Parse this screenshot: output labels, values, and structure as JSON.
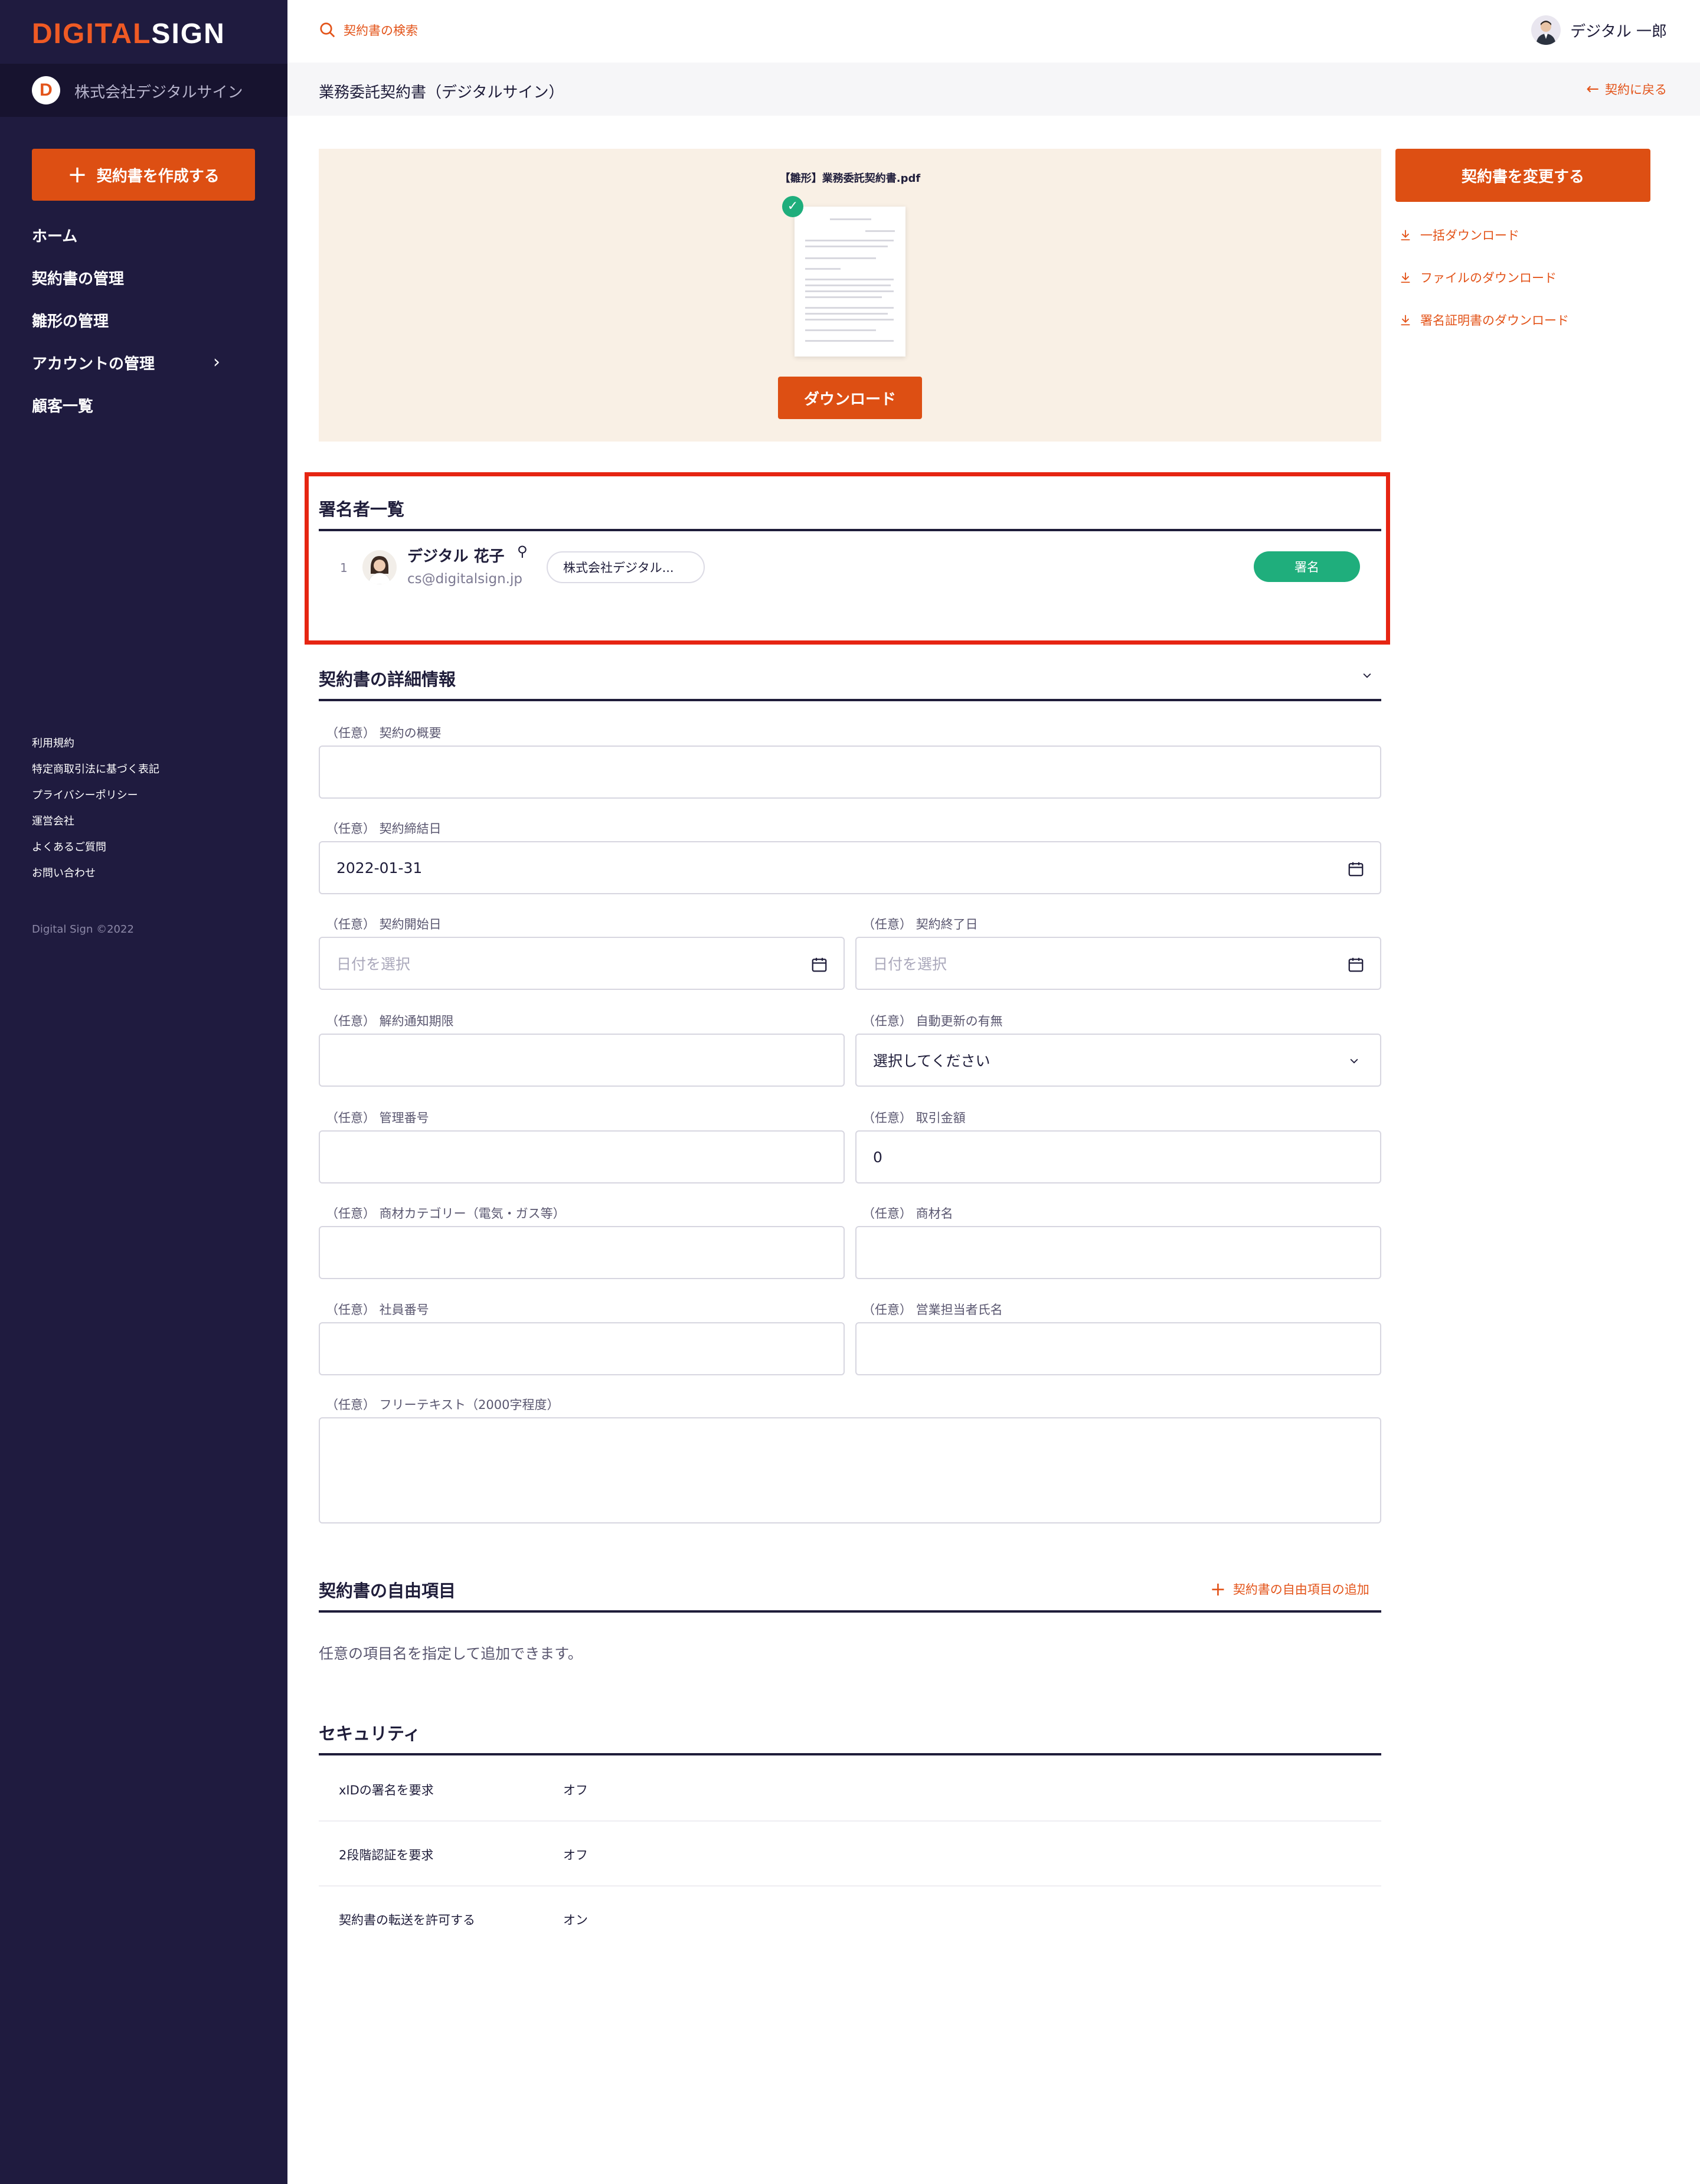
{
  "brand": {
    "logo_part1": "DIGITAL",
    "logo_part2": "SIGN",
    "accent": "#dd4f13",
    "sidebar_bg": "#1f1b3f"
  },
  "sidebar": {
    "company_initial": "D",
    "company_name": "株式会社デジタルサイン",
    "create_button": "契約書を作成する",
    "nav": [
      "ホーム",
      "契約書の管理",
      "雛形の管理",
      "アカウントの管理",
      "顧客一覧"
    ],
    "footer_links": [
      "利用規約",
      "特定商取引法に基づく表記",
      "プライバシーポリシー",
      "運営会社",
      "よくあるご質問",
      "お問い合わせ"
    ],
    "copyright": "Digital Sign ©2022"
  },
  "header": {
    "search_label": "契約書の検索",
    "user_name": "デジタル 一郎",
    "page_title": "業務委託契約書（デジタルサイン）",
    "back_link": "契約に戻る"
  },
  "preview": {
    "file_name": "【雛形】業務委託契約書.pdf",
    "download_button": "ダウンロード"
  },
  "actions": {
    "change_button": "契約書を変更する",
    "links": [
      "一括ダウンロード",
      "ファイルのダウンロード",
      "署名証明書のダウンロード"
    ]
  },
  "signers": {
    "title": "署名者一覧",
    "items": [
      {
        "number": "1",
        "name": "デジタル 花子",
        "email": "cs@digitalsign.jp",
        "company": "株式会社デジタル...",
        "status": "署名"
      }
    ]
  },
  "details": {
    "title": "契約書の詳細情報",
    "fields": {
      "summary": {
        "label": "（任意） 契約の概要",
        "value": ""
      },
      "signed_date": {
        "label": "（任意） 契約締結日",
        "value": "2022-01-31"
      },
      "start_date": {
        "label": "（任意） 契約開始日",
        "placeholder": "日付を選択"
      },
      "end_date": {
        "label": "（任意） 契約終了日",
        "placeholder": "日付を選択"
      },
      "notice": {
        "label": "（任意） 解約通知期限",
        "value": ""
      },
      "auto_renew": {
        "label": "（任意） 自動更新の有無",
        "value": "選択してください"
      },
      "management_no": {
        "label": "（任意） 管理番号",
        "value": ""
      },
      "amount": {
        "label": "（任意） 取引金額",
        "value": "0"
      },
      "category": {
        "label": "（任意） 商材カテゴリー（電気・ガス等）",
        "value": ""
      },
      "product": {
        "label": "（任意） 商材名",
        "value": ""
      },
      "employee_no": {
        "label": "（任意） 社員番号",
        "value": ""
      },
      "sales_rep": {
        "label": "（任意） 営業担当者氏名",
        "value": ""
      },
      "free_text": {
        "label": "（任意） フリーテキスト（2000字程度）",
        "value": ""
      }
    }
  },
  "free_items": {
    "title": "契約書の自由項目",
    "add_link": "契約書の自由項目の追加",
    "description": "任意の項目名を指定して追加できます。"
  },
  "security": {
    "title": "セキュリティ",
    "rows": [
      {
        "label": "xIDの署名を要求",
        "value": "オフ"
      },
      {
        "label": "2段階認証を要求",
        "value": "オフ"
      },
      {
        "label": "契約書の転送を許可する",
        "value": "オン"
      }
    ]
  }
}
